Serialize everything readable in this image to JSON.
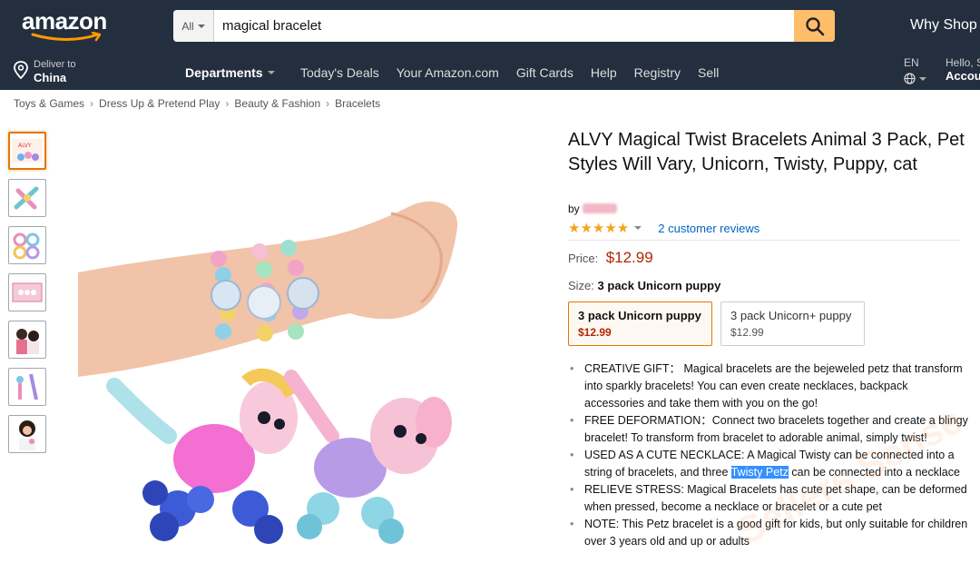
{
  "header": {
    "logo_text": "amazon",
    "search": {
      "dept_label": "All",
      "query": "magical bracelet"
    },
    "why_shop": "Why Shop"
  },
  "nav": {
    "deliver_line1": "Deliver to",
    "deliver_line2": "China",
    "departments": "Departments",
    "links": [
      "Today's Deals",
      "Your Amazon.com",
      "Gift Cards",
      "Help",
      "Registry",
      "Sell"
    ],
    "lang": "EN",
    "hello": "Hello, S",
    "account": "Accou"
  },
  "breadcrumb": [
    "Toys & Games",
    "Dress Up & Pretend Play",
    "Beauty & Fashion",
    "Bracelets"
  ],
  "product": {
    "title": "ALVY Magical Twist Bracelets Animal 3 Pack, Pet Styles Will Vary, Unicorn, Twisty, Puppy, cat",
    "by": "by",
    "stars": "★★★★★",
    "reviews": "2 customer reviews",
    "price_label": "Price:",
    "price": "$12.99",
    "size_label": "Size:",
    "size_value": "3 pack Unicorn puppy",
    "options": [
      {
        "name": "3 pack Unicorn puppy",
        "price": "$12.99"
      },
      {
        "name": "3 pack Unicorn+ puppy",
        "price": "$12.99"
      }
    ],
    "bullets": {
      "b1": "CREATIVE GIFT： Magical bracelets are the bejeweled petz that transform into sparkly bracelets! You can even create necklaces, backpack accessories and take them with you on the go!",
      "b2": "FREE DEFORMATION：Connect two bracelets together and create a blingy bracelet! To transform from bracelet to adorable animal, simply twist!",
      "b3_pre": "USED AS A CUTE NECKLACE: A Magical Twisty can be connected into a string of bracelets, and three ",
      "b3_hl": "Twisty Petz",
      "b3_post": " can be connected into a necklace",
      "b4": "RELIEVE STRESS: Magical Bracelets has cute pet shape, can be deformed when pressed, become a necklace or bracelet or a cute pet",
      "b5": "NOTE: This Petz bracelet is a good gift for kids, but only suitable for children over 3 years old and up or adults"
    },
    "bullet_mark": "•"
  },
  "watermark": "Sellers Sense",
  "colors": {
    "header_bg": "#232f3e",
    "search_button": "#febd69",
    "price": "#b12704",
    "link": "#0066c0",
    "star": "#f4a41c",
    "selected_border": "#e77600"
  }
}
